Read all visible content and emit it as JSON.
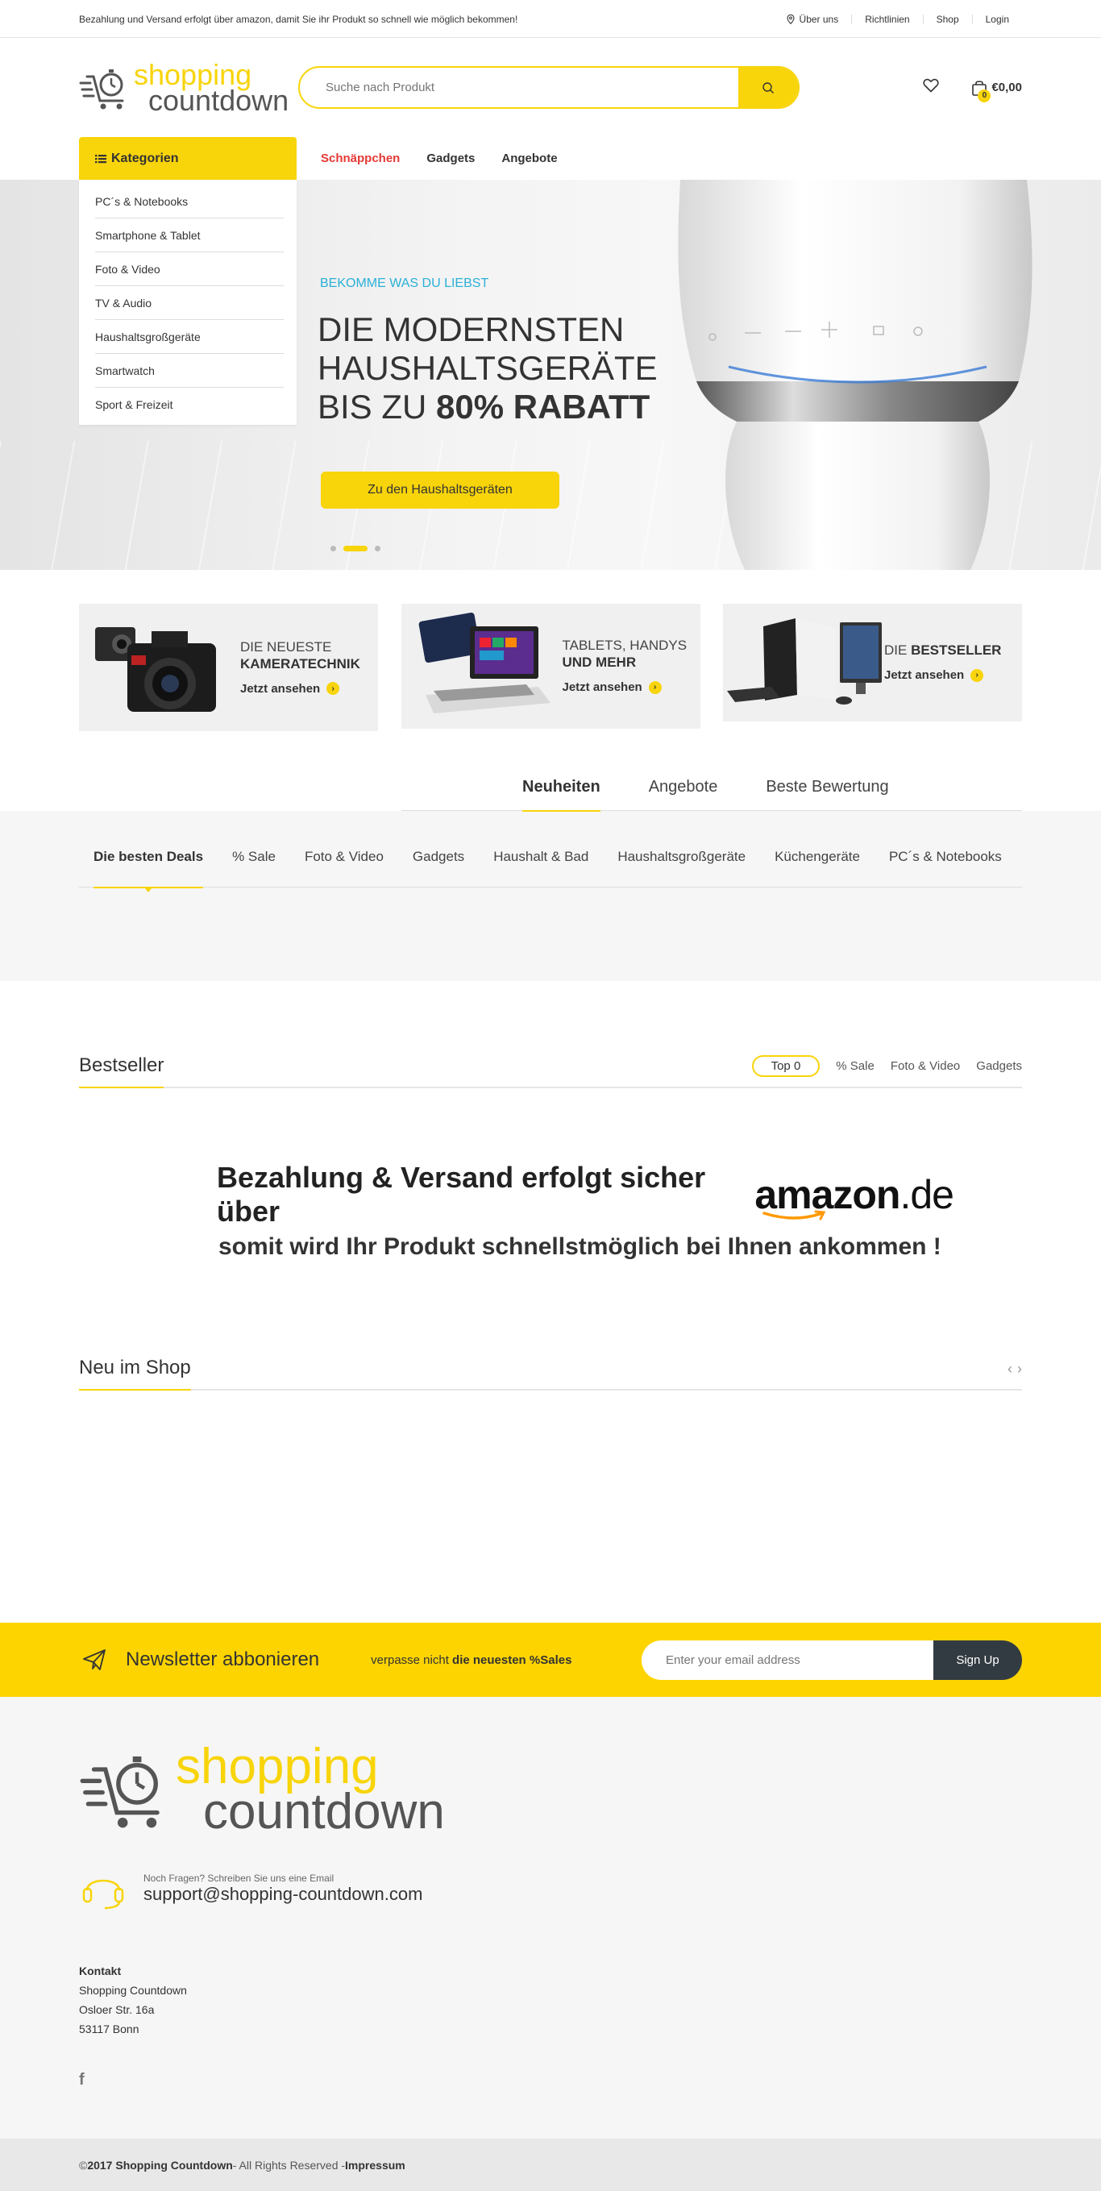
{
  "topbar": {
    "notice": "Bezahlung und Versand erfolgt über amazon, damit Sie ihr Produkt so schnell wie möglich bekommen!",
    "links": [
      "Über uns",
      "Richtlinien",
      "Shop",
      "Login"
    ]
  },
  "header": {
    "logo_line1": "shopping",
    "logo_line2": "countdown",
    "search_placeholder": "Suche nach Produkt",
    "cart_total": "€0,00",
    "cart_count": "0"
  },
  "nav": {
    "categories_label": "Kategorien",
    "menu": [
      "Schnäppchen",
      "Gadgets",
      "Angebote"
    ]
  },
  "categories": [
    "PC´s & Notebooks",
    "Smartphone & Tablet",
    "Foto & Video",
    "TV & Audio",
    "Haushaltsgroßgeräte",
    "Smartwatch",
    "Sport & Freizeit"
  ],
  "hero": {
    "subtitle": "BEKOMME WAS DU LIEBST",
    "title_line1": "DIE MODERNSTEN",
    "title_line2": "HAUSHALTSGERÄTE",
    "title_line3_prefix": "BIS ZU ",
    "title_line3_bold": "80% RABATT",
    "button": "Zu den Haushaltsgeräten"
  },
  "promos": [
    {
      "line1": "DIE NEUESTE",
      "line2": "KAMERATECHNIK",
      "link": "Jetzt ansehen"
    },
    {
      "line1": "TABLETS, HANDYS",
      "line2": "UND MEHR",
      "link": "Jetzt ansehen"
    },
    {
      "line1": "DIE ",
      "line2": "BESTSELLER",
      "link": "Jetzt ansehen"
    }
  ],
  "main_tabs": [
    "Neuheiten",
    "Angebote",
    "Beste Bewertung"
  ],
  "deal_tabs": [
    "Die besten Deals",
    "% Sale",
    "Foto & Video",
    "Gadgets",
    "Haushalt & Bad",
    "Haushaltsgroßgeräte",
    "Küchengeräte",
    "PC´s & Notebooks"
  ],
  "bestseller": {
    "title": "Bestseller",
    "tabs": [
      "Top 0",
      "% Sale",
      "Foto & Video",
      "Gadgets"
    ]
  },
  "amazon_banner": {
    "line1": "Bezahlung & Versand erfolgt sicher über",
    "brand": "amazon",
    "brand_suffix": ".de",
    "line2": "somit wird Ihr Produkt schnellstmöglich bei Ihnen ankommen !"
  },
  "new_in_shop": {
    "title": "Neu im Shop"
  },
  "newsletter": {
    "title": "Newsletter abbonieren",
    "sub_prefix": "verpasse nicht ",
    "sub_bold": "die neuesten %Sales",
    "placeholder": "Enter your email address",
    "button": "Sign Up"
  },
  "footer": {
    "logo_line1": "shopping",
    "logo_line2": "countdown",
    "question": "Noch Fragen? Schreiben Sie uns eine Email",
    "email": "support@shopping-countdown.com",
    "kontakt_title": "Kontakt",
    "kontakt_lines": [
      "Shopping Countdown",
      "Osloer Str. 16a",
      "53117 Bonn"
    ],
    "social_icon": "f"
  },
  "copyright": {
    "prefix": "© ",
    "brand": "2017 Shopping Countdown",
    "middle": " - All Rights Reserved - ",
    "link": "Impressum"
  },
  "colors": {
    "accent": "#f8d40a",
    "hot": "#e53935",
    "subtitle": "#2ab0d8",
    "dark_button": "#333b42"
  }
}
